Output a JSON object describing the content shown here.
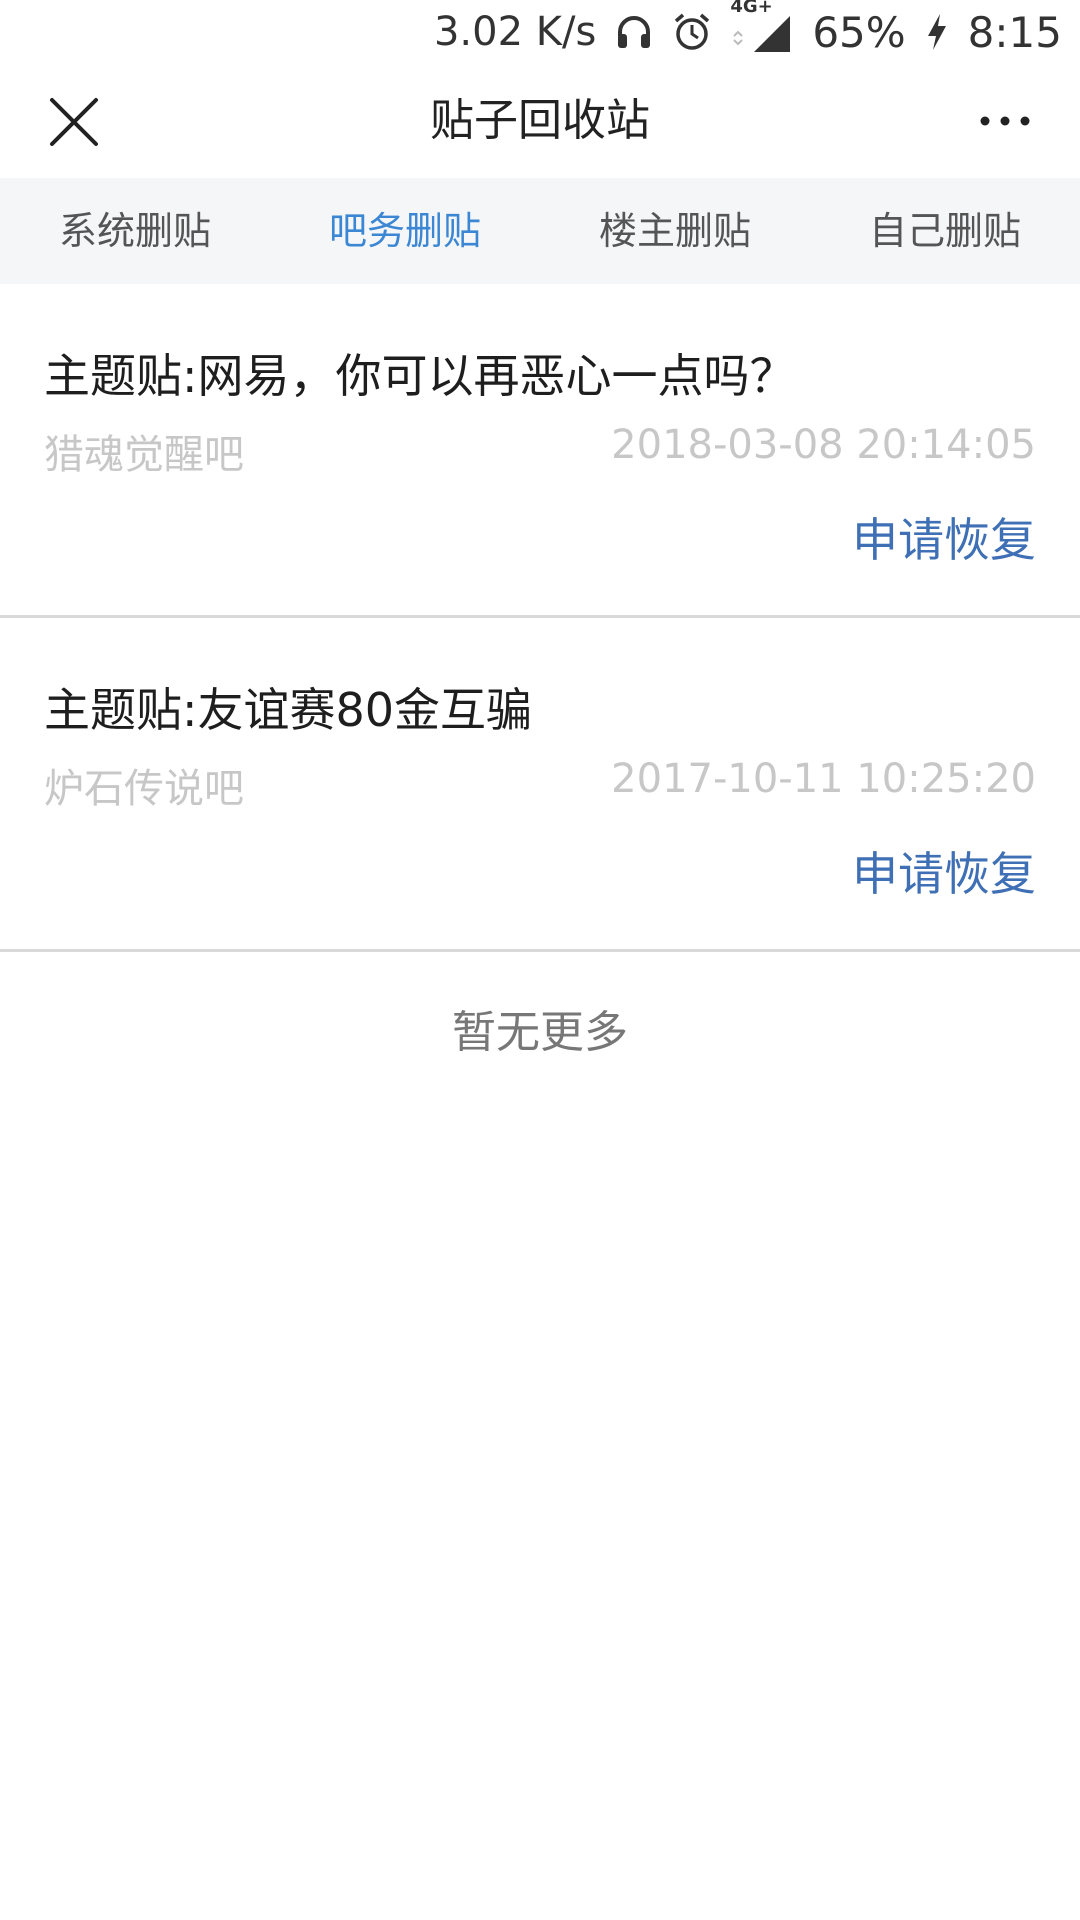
{
  "status_bar": {
    "net_speed": "3.02 K/s",
    "network_tag": "4G+",
    "battery": "65%",
    "time": "8:15",
    "icons": [
      "headphones-icon",
      "alarm-icon",
      "signal-icon",
      "charging-icon"
    ]
  },
  "header": {
    "title": "贴子回收站",
    "close_icon": "close-icon",
    "more_icon": "more-icon"
  },
  "tabs": [
    {
      "label": "系统删贴",
      "active": false
    },
    {
      "label": "吧务删贴",
      "active": true
    },
    {
      "label": "楼主删贴",
      "active": false
    },
    {
      "label": "自己删贴",
      "active": false
    }
  ],
  "posts": [
    {
      "title": "主题贴:网易，你可以再恶心一点吗？",
      "forum": "猎魂觉醒吧",
      "time": "2018-03-08 20:14:05",
      "action": "申请恢复"
    },
    {
      "title": "主题贴:友谊赛80金互骗",
      "forum": "炉石传说吧",
      "time": "2017-10-11 10:25:20",
      "action": "申请恢复"
    }
  ],
  "footer": {
    "no_more": "暂无更多"
  },
  "colors": {
    "accent": "#3b87d4",
    "action": "#3f6fb4",
    "tab_bg": "#f5f6f8",
    "muted": "#c7c7c7"
  }
}
